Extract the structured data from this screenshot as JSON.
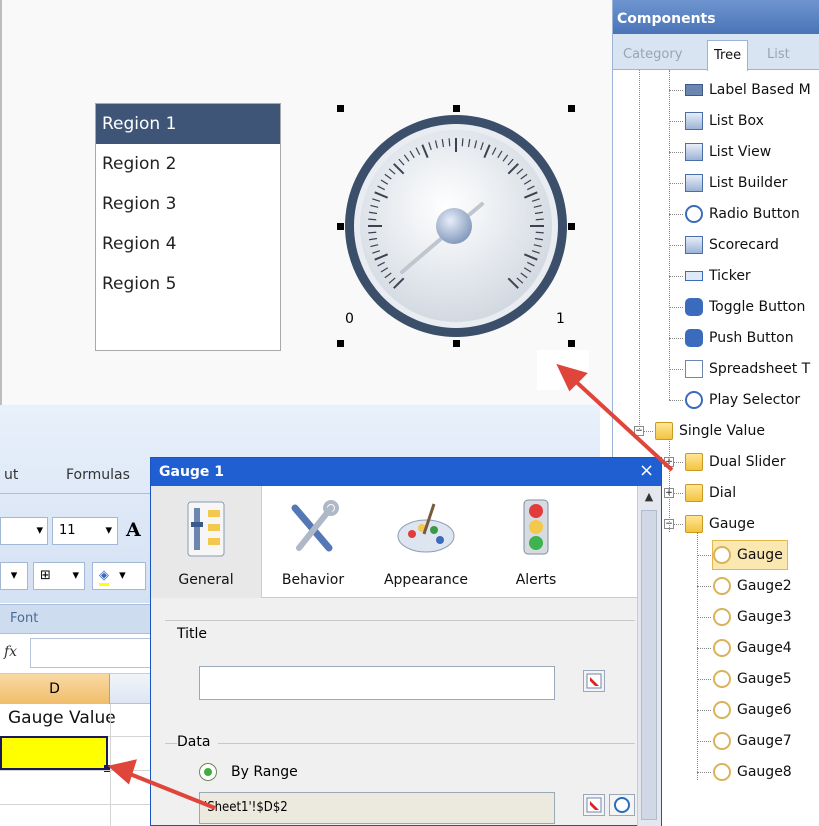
{
  "canvas": {
    "listbox_items": [
      "Region 1",
      "Region 2",
      "Region 3",
      "Region 4",
      "Region 5"
    ],
    "gauge": {
      "min_label": "0",
      "max_label": "1"
    }
  },
  "components": {
    "title": "Components",
    "tabs": [
      "Category",
      "Tree",
      "List"
    ],
    "active_tab": "Tree",
    "tree": [
      {
        "label": "Label Based M",
        "icon": "label-based-menu-icon"
      },
      {
        "label": "List Box",
        "icon": "list-box-icon"
      },
      {
        "label": "List View",
        "icon": "list-view-icon"
      },
      {
        "label": "List Builder",
        "icon": "list-builder-icon"
      },
      {
        "label": "Radio Button",
        "icon": "radio-button-icon"
      },
      {
        "label": "Scorecard",
        "icon": "scorecard-icon"
      },
      {
        "label": "Ticker",
        "icon": "ticker-icon"
      },
      {
        "label": "Toggle Button",
        "icon": "toggle-button-icon"
      },
      {
        "label": "Push Button",
        "icon": "push-button-icon"
      },
      {
        "label": "Spreadsheet T",
        "icon": "spreadsheet-table-icon"
      },
      {
        "label": "Play Selector",
        "icon": "play-selector-icon"
      },
      {
        "label": "Single Value",
        "icon": "folder-icon"
      },
      {
        "label": "Dual Slider",
        "icon": "folder-icon"
      },
      {
        "label": "Dial",
        "icon": "folder-icon"
      },
      {
        "label": "Gauge",
        "icon": "folder-icon"
      },
      {
        "label": "Gauge",
        "icon": "gauge-icon"
      },
      {
        "label": "Gauge2",
        "icon": "gauge-icon"
      },
      {
        "label": "Gauge3",
        "icon": "gauge-icon"
      },
      {
        "label": "Gauge4",
        "icon": "gauge-icon"
      },
      {
        "label": "Gauge5",
        "icon": "gauge-icon"
      },
      {
        "label": "Gauge6",
        "icon": "gauge-icon"
      },
      {
        "label": "Gauge7",
        "icon": "gauge-icon"
      },
      {
        "label": "Gauge8",
        "icon": "gauge-icon"
      }
    ]
  },
  "excel": {
    "tabs": [
      "ut",
      "Formulas"
    ],
    "font_size": "11",
    "font_group_label": "Font",
    "fx_label": "fx",
    "column_header": "D",
    "cell_text": "Gauge Value",
    "highlight_color": "#ffff00"
  },
  "dialog": {
    "title": "Gauge 1",
    "close": "×",
    "tabs": [
      "General",
      "Behavior",
      "Appearance",
      "Alerts"
    ],
    "title_label": "Title",
    "title_value": "",
    "data_label": "Data",
    "by_range_label": "By Range",
    "range_value": "'Sheet1'!$D$2"
  },
  "colors": {
    "accent": "#1f5fd1",
    "arrow": "#e0453b",
    "selection": "#3e5578"
  }
}
